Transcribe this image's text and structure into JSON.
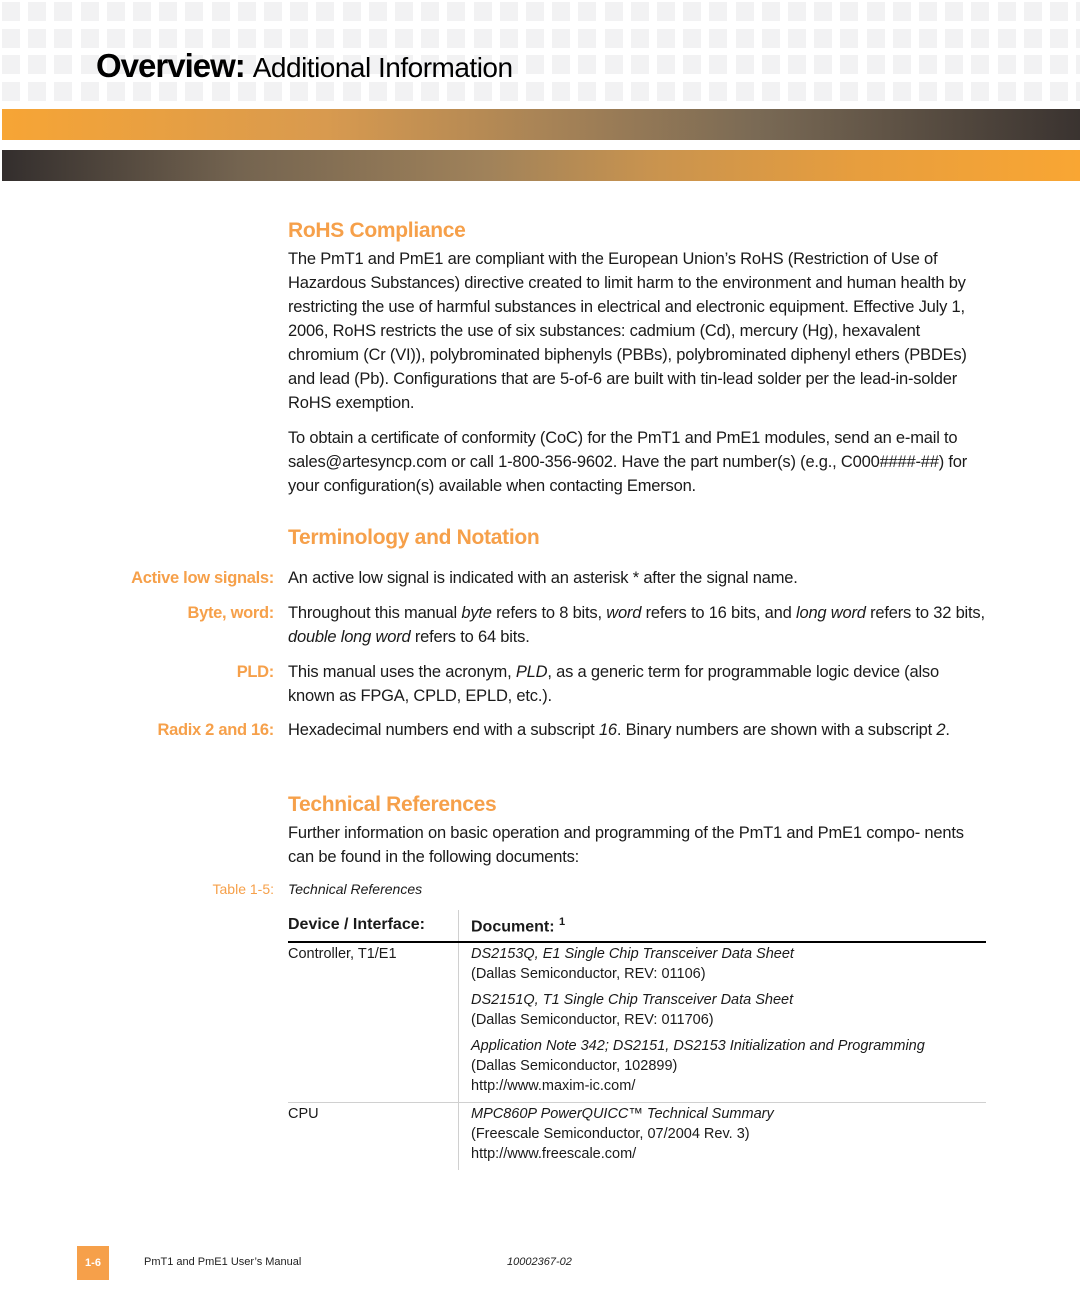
{
  "header": {
    "title_bold": "Overview:",
    "title_light": "Additional Information"
  },
  "colors": {
    "accent_orange": "#f6a04a",
    "text": "#1a1a1a",
    "grid_cell": "#f2f2f3"
  },
  "sections": {
    "rohs": {
      "heading": "RoHS Compliance",
      "paragraphs": [
        "The PmT1 and PmE1 are compliant with the European Union’s RoHS (Restriction of Use of Hazardous Substances) directive created to limit harm to the environment and human health by restricting the use of harmful substances in electrical and electronic equipment. Effective July 1, 2006, RoHS restricts the use of six substances: cadmium (Cd), mercury (Hg), hexavalent chromium (Cr (VI)), polybrominated biphenyls (PBBs), polybrominated diphenyl ethers (PBDEs) and lead (Pb). Configurations that are 5-of-6 are built with tin-lead solder per the lead-in-solder RoHS exemption.",
        "To obtain a certificate of conformity (CoC) for the PmT1 and PmE1 modules, send an e-mail to sales@artesyncp.com or call 1-800-356-9602. Have the part number(s) (e.g., C000####-##) for your configuration(s) available when contacting Emerson."
      ]
    },
    "terminology": {
      "heading": "Terminology and Notation",
      "terms": [
        {
          "label": "Active low signals:",
          "text_parts": [
            {
              "t": "An active low signal is indicated with an asterisk * after the signal name.",
              "i": false
            }
          ]
        },
        {
          "label": "Byte, word:",
          "text_parts": [
            {
              "t": "Throughout this manual ",
              "i": false
            },
            {
              "t": "byte",
              "i": true
            },
            {
              "t": " refers to 8 bits, ",
              "i": false
            },
            {
              "t": "word",
              "i": true
            },
            {
              "t": " refers to 16 bits, and ",
              "i": false
            },
            {
              "t": "long word",
              "i": true
            },
            {
              "t": " refers to 32 bits, ",
              "i": false
            },
            {
              "t": "double long word",
              "i": true
            },
            {
              "t": " refers to 64 bits.",
              "i": false
            }
          ]
        },
        {
          "label": "PLD:",
          "text_parts": [
            {
              "t": "This manual uses the acronym, ",
              "i": false
            },
            {
              "t": "PLD",
              "i": true
            },
            {
              "t": ", as a generic term for programmable logic device (also known as FPGA, CPLD, EPLD, etc.).",
              "i": false
            }
          ]
        },
        {
          "label": "Radix 2 and 16:",
          "text_parts": [
            {
              "t": "Hexadecimal numbers end with a subscript ",
              "i": false
            },
            {
              "t": "16",
              "i": true
            },
            {
              "t": ". Binary numbers are shown with a subscript ",
              "i": false
            },
            {
              "t": "2",
              "i": true
            },
            {
              "t": ".",
              "i": false
            }
          ]
        }
      ]
    },
    "references": {
      "heading": "Technical References",
      "intro": "Further information on basic operation and programming of the PmT1 and PmE1 compo- nents can be found in the following documents:",
      "table_caption_label": "Table 1-5:",
      "table_caption_text": "Technical References",
      "columns": [
        "Device / Interface:",
        "Document:"
      ],
      "column2_footnote": "1",
      "rows": [
        {
          "device": "Controller, T1/E1",
          "documents": [
            {
              "title": "DS2153Q, E1 Single Chip Transceiver Data Sheet",
              "lines": [
                "(Dallas Semiconductor, REV: 01106)"
              ]
            },
            {
              "title": "DS2151Q, T1 Single Chip Transceiver Data Sheet",
              "lines": [
                "(Dallas Semiconductor, REV: 011706)"
              ]
            },
            {
              "title": "Application Note 342; DS2151, DS2153 Initialization and Programming",
              "lines": [
                "(Dallas Semiconductor, 102899)",
                "http://www.maxim-ic.com/"
              ]
            }
          ]
        },
        {
          "device": "CPU",
          "documents": [
            {
              "title": "MPC860P PowerQUICC™ Technical Summary",
              "lines": [
                "(Freescale Semiconductor, 07/2004 Rev. 3)",
                "http://www.freescale.com/"
              ]
            }
          ]
        }
      ]
    }
  },
  "footer": {
    "page_number": "1-6",
    "manual_title": "PmT1 and PmE1 User’s Manual",
    "doc_number": "10002367-02"
  }
}
